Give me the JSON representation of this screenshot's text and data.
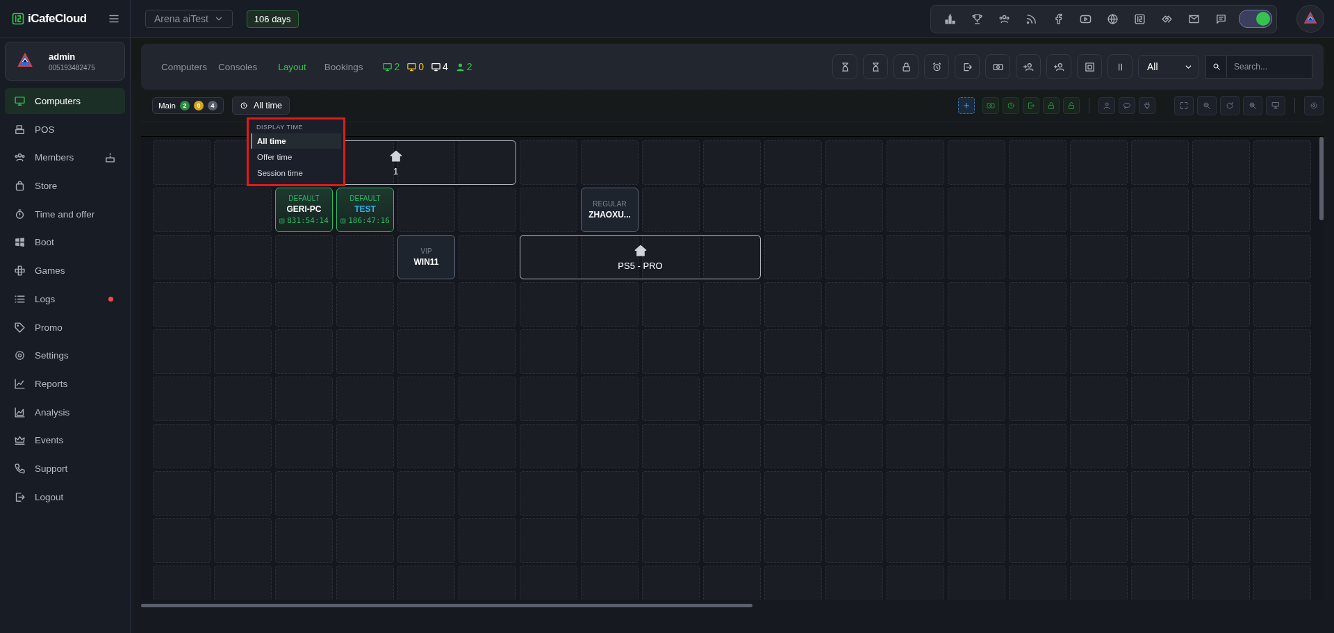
{
  "brand": {
    "name": "iCafeCloud"
  },
  "topbar": {
    "venue": "Arena aiTest",
    "license": "106 days",
    "toggle": {
      "on": true
    }
  },
  "user": {
    "name": "admin",
    "id": "005193482475"
  },
  "sidebar": {
    "items": [
      {
        "label": "Computers",
        "selected": true
      },
      {
        "label": "POS",
        "selected": false
      },
      {
        "label": "Members",
        "selected": false,
        "birthday": true
      },
      {
        "label": "Store",
        "selected": false
      },
      {
        "label": "Time and offer",
        "selected": false
      },
      {
        "label": "Boot",
        "selected": false
      },
      {
        "label": "Games",
        "selected": false
      },
      {
        "label": "Logs",
        "selected": false,
        "alert": true
      },
      {
        "label": "Promo",
        "selected": false
      },
      {
        "label": "Settings",
        "selected": false
      },
      {
        "label": "Reports",
        "selected": false
      },
      {
        "label": "Analysis",
        "selected": false
      },
      {
        "label": "Events",
        "selected": false
      },
      {
        "label": "Support",
        "selected": false
      },
      {
        "label": "Logout",
        "selected": false
      }
    ]
  },
  "tabs": [
    {
      "label": "Computers",
      "selected": false
    },
    {
      "label": "Consoles",
      "selected": false
    },
    {
      "label": "Layout",
      "selected": true
    },
    {
      "label": "Bookings",
      "selected": false
    }
  ],
  "counts": [
    {
      "kind": "online",
      "value": "2"
    },
    {
      "kind": "busy",
      "value": "0"
    },
    {
      "kind": "total",
      "value": "4"
    },
    {
      "kind": "users",
      "value": "2"
    }
  ],
  "filter": {
    "value": "All"
  },
  "search": {
    "placeholder": "Search..."
  },
  "room": {
    "label": "Main",
    "counts": [
      {
        "kind": "online",
        "value": "2"
      },
      {
        "kind": "busy",
        "value": "0"
      },
      {
        "kind": "total",
        "value": "4"
      }
    ]
  },
  "time_button": {
    "label": "All time"
  },
  "display_time_menu": {
    "title": "DISPLAY TIME",
    "options": [
      {
        "label": "All time",
        "selected": true
      },
      {
        "label": "Offer time",
        "selected": false
      },
      {
        "label": "Session time",
        "selected": false
      }
    ]
  },
  "tiles": [
    {
      "kind": "group",
      "label": "1"
    },
    {
      "kind": "pc",
      "group": "DEFAULT",
      "name": "GERI-PC",
      "time": "831:54:14",
      "online": true,
      "highlighted": false
    },
    {
      "kind": "pc",
      "group": "DEFAULT",
      "name": "TEST",
      "time": "186:47:16",
      "online": true,
      "highlighted": true
    },
    {
      "kind": "pc",
      "group": "REGULAR",
      "name": "ZHAOXU...",
      "online": false,
      "highlighted": false
    },
    {
      "kind": "pc",
      "group": "VIP",
      "name": "WIN11",
      "online": false,
      "highlighted": false
    },
    {
      "kind": "group",
      "label": "PS5 - PRO"
    }
  ]
}
